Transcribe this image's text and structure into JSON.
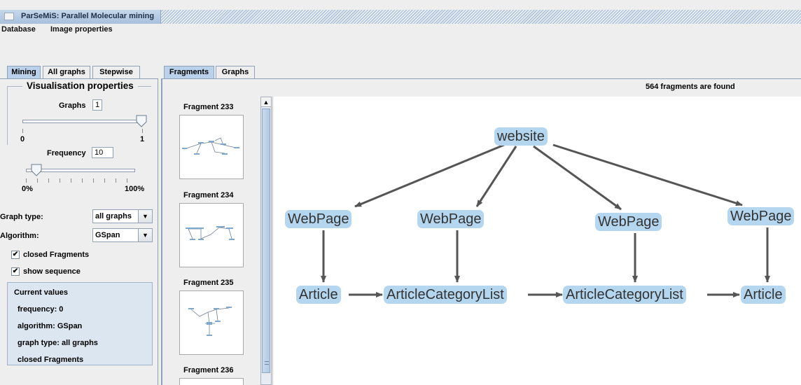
{
  "window": {
    "title": "ParSeMiS: Parallel Molecular mining"
  },
  "menu": [
    "Database",
    "Image properties"
  ],
  "left_tabs": [
    "Mining",
    "All graphs",
    "Stepwise"
  ],
  "right_tabs": [
    "Fragments",
    "Graphs"
  ],
  "visualisation": {
    "title": "Visualisation properties",
    "graphs_label": "Graphs",
    "graphs_value": "1",
    "graphs_min": "0",
    "graphs_max": "1",
    "graphs_slider_level": 1.0,
    "frequency_label": "Frequency",
    "frequency_value": "10",
    "freq_min": "0%",
    "freq_max": "100%",
    "freq_slider_level": 0.1
  },
  "settings": {
    "graph_type_label": "Graph type:",
    "graph_type_value": "all graphs",
    "algorithm_label": "Algorithm:",
    "algorithm_value": "GSpan",
    "closed_fragments_label": "closed Fragments",
    "closed_fragments_checked": true,
    "show_sequence_label": "show sequence",
    "show_sequence_checked": true
  },
  "current_values": {
    "title": "Current values",
    "frequency": "frequency: 0",
    "algorithm": "algorithm: GSpan",
    "graph_type": "graph type: all graphs",
    "closed": "closed Fragments"
  },
  "fragments": {
    "count_text": "564 fragments are found",
    "list": [
      "Fragment 233",
      "Fragment 234",
      "Fragment 235",
      "Fragment 236"
    ]
  },
  "graph": {
    "nodes": {
      "website": "website",
      "webpage1": "WebPage",
      "webpage2": "WebPage",
      "webpage3": "WebPage",
      "webpage4": "WebPage",
      "article1": "Article",
      "acl1": "ArticleCategoryList",
      "acl2": "ArticleCategoryList",
      "article2": "Article"
    },
    "node_color": "#b4d6ef",
    "edge_color": "#555555"
  },
  "colors": {
    "tab_active": "#b9d1ea",
    "panel_info": "#dce6f1",
    "titlebar": "#a8c0dc"
  }
}
